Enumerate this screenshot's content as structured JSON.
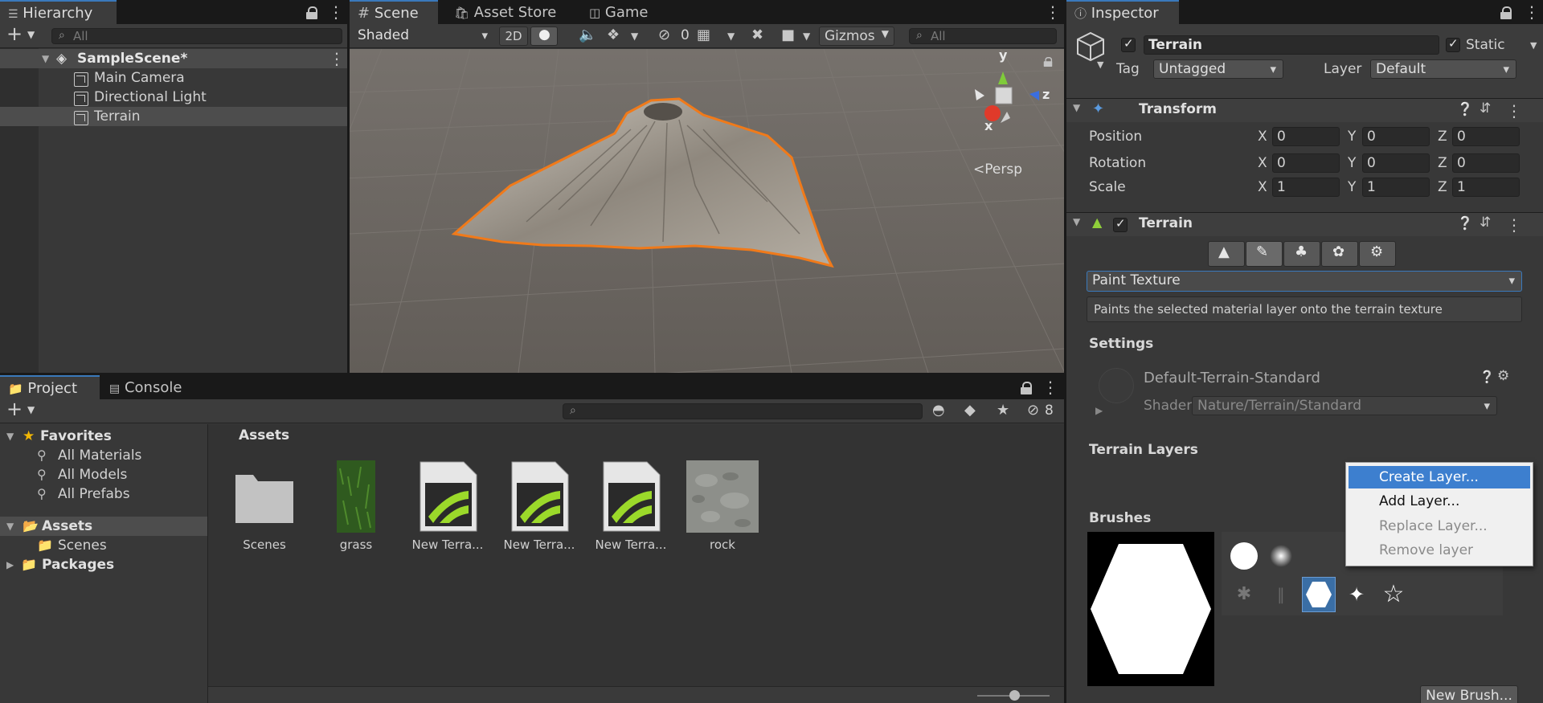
{
  "hierarchy": {
    "tab_label": "Hierarchy",
    "search_placeholder": "All",
    "scene_name": "SampleScene*",
    "items": [
      {
        "label": "Main Camera"
      },
      {
        "label": "Directional Light"
      },
      {
        "label": "Terrain"
      }
    ]
  },
  "scene_view": {
    "tabs": [
      {
        "label": "Scene"
      },
      {
        "label": "Asset Store"
      },
      {
        "label": "Game"
      }
    ],
    "shading_mode": "Shaded",
    "mode_2d": "2D",
    "hidden_count": "0",
    "gizmos_label": "Gizmos",
    "search_placeholder": "All",
    "axis_y": "y",
    "axis_z": "z",
    "axis_x": "x",
    "projection": "Persp"
  },
  "project": {
    "tabs": [
      {
        "label": "Project"
      },
      {
        "label": "Console"
      }
    ],
    "hidden_count": "8",
    "favorites": {
      "label": "Favorites",
      "items": [
        {
          "label": "All Materials"
        },
        {
          "label": "All Models"
        },
        {
          "label": "All Prefabs"
        }
      ]
    },
    "tree": {
      "assets_label": "Assets",
      "scenes_label": "Scenes",
      "packages_label": "Packages"
    },
    "breadcrumb": "Assets",
    "assets": [
      {
        "name": "Scenes",
        "kind": "folder"
      },
      {
        "name": "grass",
        "kind": "texture"
      },
      {
        "name": "New Terra...",
        "kind": "terrain-data"
      },
      {
        "name": "New Terra...",
        "kind": "terrain-data"
      },
      {
        "name": "New Terra...",
        "kind": "terrain-data"
      },
      {
        "name": "rock",
        "kind": "texture"
      }
    ]
  },
  "inspector": {
    "tab_label": "Inspector",
    "object_name": "Terrain",
    "static_label": "Static",
    "tag_label": "Tag",
    "tag_value": "Untagged",
    "layer_label": "Layer",
    "layer_value": "Default",
    "transform": {
      "title": "Transform",
      "position_label": "Position",
      "rotation_label": "Rotation",
      "scale_label": "Scale",
      "axis_x": "X",
      "axis_y": "Y",
      "axis_z": "Z",
      "position": [
        "0",
        "0",
        "0"
      ],
      "rotation": [
        "0",
        "0",
        "0"
      ],
      "scale": [
        "1",
        "1",
        "1"
      ]
    },
    "terrain": {
      "title": "Terrain",
      "tool_dropdown": "Paint Texture",
      "tool_description": "Paints the selected material layer onto the terrain texture",
      "settings_label": "Settings",
      "material_name": "Default-Terrain-Standard",
      "shader_label": "Shader",
      "shader_value": "Nature/Terrain/Standard",
      "terrain_layers_label": "Terrain Layers",
      "brushes_label": "Brushes",
      "new_brush_button": "New Brush..."
    },
    "context_menu": {
      "items": [
        {
          "label": "Create Layer...",
          "enabled": true,
          "highlighted": true
        },
        {
          "label": "Add Layer...",
          "enabled": true,
          "highlighted": false
        },
        {
          "label": "Replace Layer...",
          "enabled": false,
          "highlighted": false
        },
        {
          "label": "Remove layer",
          "enabled": false,
          "highlighted": false
        }
      ]
    }
  },
  "colors": {
    "accent_blue": "#3a79bb",
    "selection_highlight": "#4d4d4d",
    "menu_highlight": "#3d7fcf",
    "terrain_outline": "#f07a1a",
    "scene_background": "#6b6661",
    "axis_y_green": "#7fcb3a",
    "axis_z_blue": "#3a6ee0",
    "axis_x_red": "#e03a2a"
  }
}
